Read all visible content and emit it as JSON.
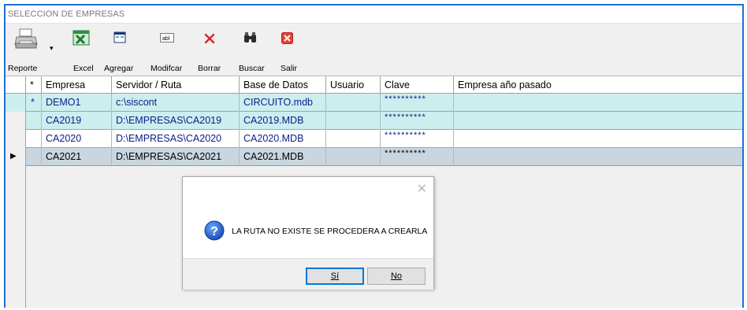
{
  "window": {
    "title": "SELECCION DE EMPRESAS"
  },
  "toolbar": {
    "reporte": "Reporte",
    "excel": "Excel",
    "agregar": "Agregar",
    "modificar": "Modifcar",
    "borrar": "Borrar",
    "buscar": "Buscar",
    "salir": "Salir",
    "icons": [
      "printer-icon",
      "excel-icon",
      "add-form-icon",
      "edit-field-icon",
      "delete-x-icon",
      "binoculars-icon",
      "exit-icon"
    ]
  },
  "grid": {
    "columns": [
      "*",
      "Empresa",
      "Servidor / Ruta",
      "Base de Datos",
      "Usuario",
      "Clave",
      "Empresa año pasado"
    ],
    "rows": [
      {
        "marker": "*",
        "empresa": "DEMO1",
        "ruta": "c:\\siscont",
        "base": "CIRCUITO.mdb",
        "usuario": "",
        "clave": "**********",
        "anio_pasado": ""
      },
      {
        "marker": "",
        "empresa": "CA2019",
        "ruta": "D:\\EMPRESAS\\CA2019",
        "base": "CA2019.MDB",
        "usuario": "",
        "clave": "**********",
        "anio_pasado": ""
      },
      {
        "marker": "",
        "empresa": "CA2020",
        "ruta": "D:\\EMPRESAS\\CA2020",
        "base": "CA2020.MDB",
        "usuario": "",
        "clave": "**********",
        "anio_pasado": ""
      },
      {
        "marker": "",
        "empresa": "CA2021",
        "ruta": "D:\\EMPRESAS\\CA2021",
        "base": "CA2021.MDB",
        "usuario": "",
        "clave": "**********",
        "anio_pasado": ""
      }
    ],
    "current_row_indicator": "▶"
  },
  "dialog": {
    "message": "LA RUTA NO EXISTE SE PROCEDERA A CREARLA",
    "close_glyph": "✕",
    "yes_label": "Sí",
    "no_label": "No",
    "icon": "question-icon"
  },
  "colors": {
    "row_teal": "#cdeeee",
    "row_selected": "#c9d6e0",
    "row_white": "#ffffff",
    "text_blue": "#0a1d8a",
    "frame_blue": "#1e6fd9"
  }
}
